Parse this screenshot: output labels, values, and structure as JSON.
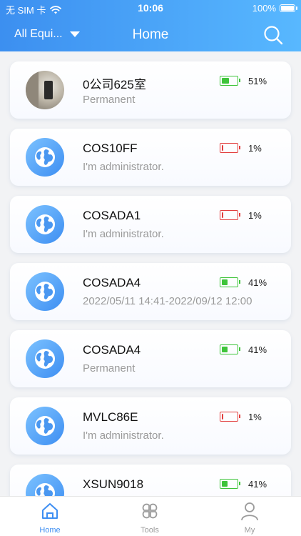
{
  "status_bar": {
    "carrier": "无 SIM 卡",
    "time": "10:06",
    "battery": "100%"
  },
  "header": {
    "filter_label": "All Equi...",
    "title": "Home"
  },
  "devices": [
    {
      "name": "0公司625室",
      "subtitle": "Permanent",
      "battery": "51%",
      "battery_level": 0.51,
      "avatar": "photo"
    },
    {
      "name": "COS10FF",
      "subtitle": "I'm administrator.",
      "battery": "1%",
      "battery_level": 0.01,
      "avatar": "globe-icon"
    },
    {
      "name": "COSADA1",
      "subtitle": "I'm administrator.",
      "battery": "1%",
      "battery_level": 0.01,
      "avatar": "globe-icon"
    },
    {
      "name": "COSADA4",
      "subtitle": "2022/05/11 14:41-2022/09/12 12:00",
      "battery": "41%",
      "battery_level": 0.41,
      "avatar": "globe-icon"
    },
    {
      "name": "COSADA4",
      "subtitle": "Permanent",
      "battery": "41%",
      "battery_level": 0.41,
      "avatar": "globe-icon"
    },
    {
      "name": "MVLC86E",
      "subtitle": "I'm administrator.",
      "battery": "1%",
      "battery_level": 0.01,
      "avatar": "globe-icon"
    },
    {
      "name": "XSUN9018",
      "subtitle": "",
      "battery": "41%",
      "battery_level": 0.41,
      "avatar": "globe-icon"
    }
  ],
  "tabs": [
    {
      "label": "Home",
      "icon": "home-icon",
      "active": true
    },
    {
      "label": "Tools",
      "icon": "tools-icon",
      "active": false
    },
    {
      "label": "My",
      "icon": "user-icon",
      "active": false
    }
  ],
  "colors": {
    "accent": "#3d8ef2",
    "battery_ok": "#3ec43a",
    "battery_low": "#e23d3d"
  }
}
